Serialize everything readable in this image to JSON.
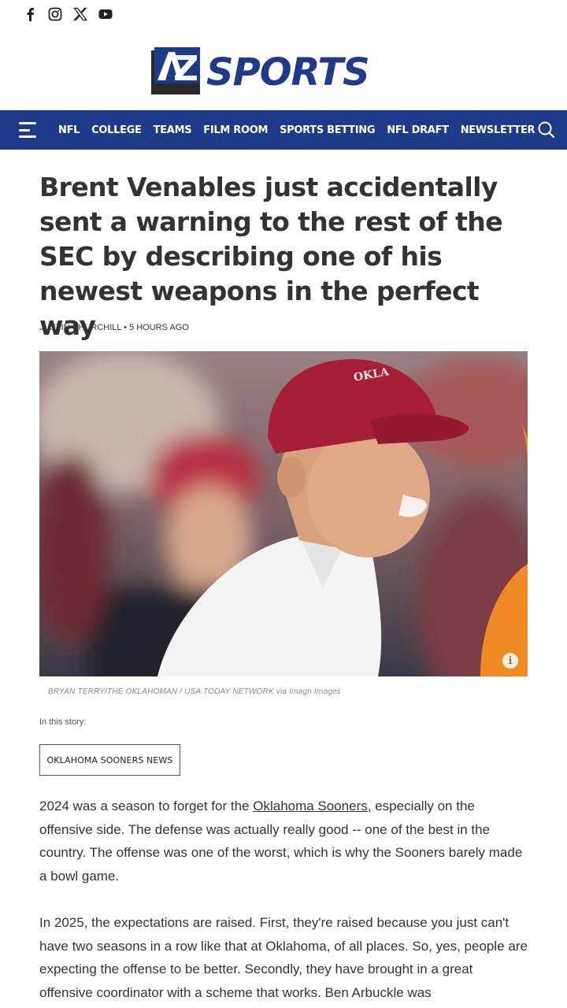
{
  "social": {
    "icons": [
      "facebook-icon",
      "instagram-icon",
      "x-icon",
      "youtube-icon"
    ]
  },
  "logo": {
    "badge_text": "AZ",
    "wordmark": "SPORTS",
    "colors": {
      "blue": "#1e3a8a",
      "dark": "#2a2a2a"
    }
  },
  "nav": {
    "items": [
      "NFL",
      "COLLEGE",
      "TEAMS",
      "FILM ROOM",
      "SPORTS BETTING",
      "NFL DRAFT",
      "NEWSLETTER"
    ],
    "bg_color": "#1e3a8a"
  },
  "article": {
    "headline": "Brent Venables just accidentally sent a warning to the rest of the SEC by describing one of his newest weapons in the perfect way",
    "byline": "JUSTIN CHURCHILL • 5 HOURS AGO",
    "image_caption": "BRYAN TERRY/THE OKLAHOMAN / USA TODAY NETWORK via Imagn Images",
    "cap_text": "OKLA",
    "in_this_story_label": "In this story:",
    "tag": "OKLAHOMA SOONERS NEWS",
    "p1_before": "2024 was a season to forget for the ",
    "p1_link": "Oklahoma Sooners",
    "p1_after": ", especially on the offensive side. The defense was actually really good -- one of the best in the country. The offense was one of the worst, which is why the Sooners barely made a bowl game.",
    "p2": "In 2025, the expectations are raised. First, they're raised because you just can't have two seasons in a row like that at Oklahoma, of all places. So, yes, people are expecting the offense to be better. Secondly, they have brought in a great offensive coordinator with a scheme that works. Ben Arbuckle was"
  }
}
